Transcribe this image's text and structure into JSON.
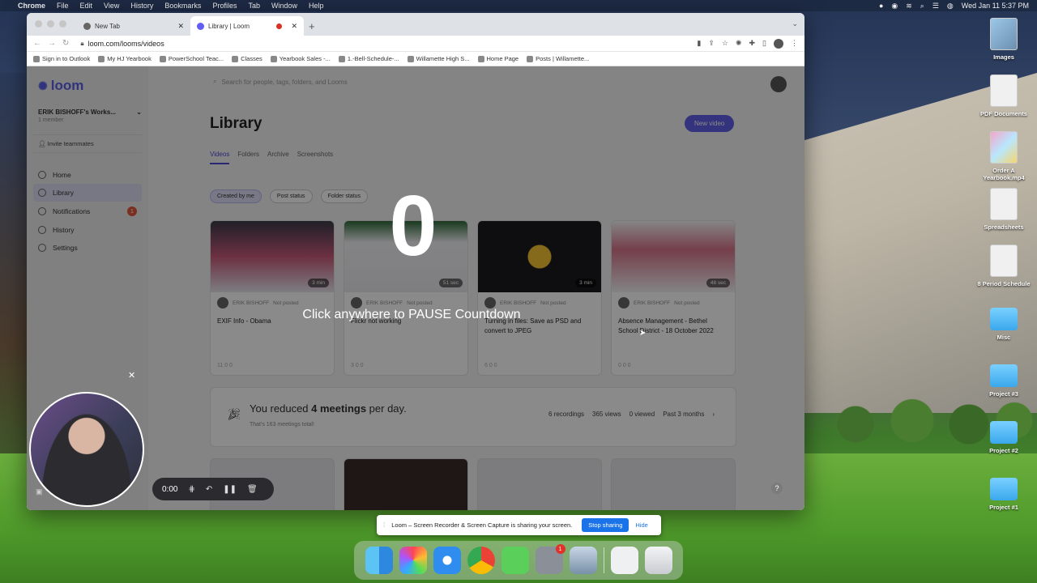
{
  "menubar": {
    "app": "Chrome",
    "items": [
      "File",
      "Edit",
      "View",
      "History",
      "Bookmarks",
      "Profiles",
      "Tab",
      "Window",
      "Help"
    ],
    "datetime": "Wed Jan 11  5:37 PM"
  },
  "browser": {
    "tabs": [
      {
        "title": "New Tab"
      },
      {
        "title": "Library | Loom"
      }
    ],
    "url": "loom.com/looms/videos",
    "bookmarks": [
      "Sign in to Outlook",
      "My HJ Yearbook",
      "PowerSchool Teac...",
      "Classes",
      "Yearbook Sales -...",
      "1.-Bell-Schedule-...",
      "Willamette High S...",
      "Home Page",
      "Posts | Willamette..."
    ]
  },
  "loom": {
    "logo": "loom",
    "workspace": "ERIK BISHOFF's Works...",
    "workspace_sub": "1 member",
    "invite": "Invite teammates",
    "nav": [
      {
        "label": "Home"
      },
      {
        "label": "Library"
      },
      {
        "label": "Notifications",
        "badge": "1"
      },
      {
        "label": "History"
      },
      {
        "label": "Settings"
      }
    ],
    "search_placeholder": "Search for people, tags, folders, and Looms",
    "title": "Library",
    "new_video": "New video",
    "tabs": [
      "Videos",
      "Folders",
      "Archive",
      "Screenshots"
    ],
    "filters": [
      "Created by me",
      "Post status",
      "Folder status"
    ],
    "cards": [
      {
        "duration": "3 min",
        "author": "ERIK BISHOFF",
        "status": "Not posted",
        "title": "EXIF Info - Obama",
        "stats": "11  0  0"
      },
      {
        "duration": "51 sec",
        "author": "ERIK BISHOFF",
        "status": "Not posted",
        "title": "Flickr not working",
        "stats": "3  0  0"
      },
      {
        "duration": "3 min",
        "author": "ERIK BISHOFF",
        "status": "Not posted",
        "title": "Turning in files: Save as PSD and convert to JPEG",
        "stats": "6  0  0"
      },
      {
        "duration": "48 sec",
        "author": "ERIK BISHOFF",
        "status": "Not posted",
        "title": "Absence Management - Bethel School District - 18 October 2022",
        "stats": "0  0  0"
      }
    ],
    "reduced": {
      "pre": "You reduced ",
      "bold": "4 meetings",
      "post": " per day.",
      "sub": "That's 163 meetings total!",
      "recordings": "6 recordings",
      "views": "365 views",
      "viewed": "0 viewed",
      "period": "Past 3 months"
    }
  },
  "overlay": {
    "countdown": "0",
    "hint": "Click anywhere to PAUSE Countdown"
  },
  "recorder": {
    "time": "0:00"
  },
  "share": {
    "message": "Loom – Screen Recorder & Screen Capture is sharing your screen.",
    "stop": "Stop sharing",
    "hide": "Hide"
  },
  "desktop": {
    "icons": [
      "Images",
      "PDF Documents",
      "Order A Yearbook.mp4",
      "Spreadsheets",
      "8 Period Schedule",
      "Misc",
      "Project #3",
      "Project #2",
      "Project #1"
    ]
  },
  "dock": {
    "settings_badge": "1"
  }
}
